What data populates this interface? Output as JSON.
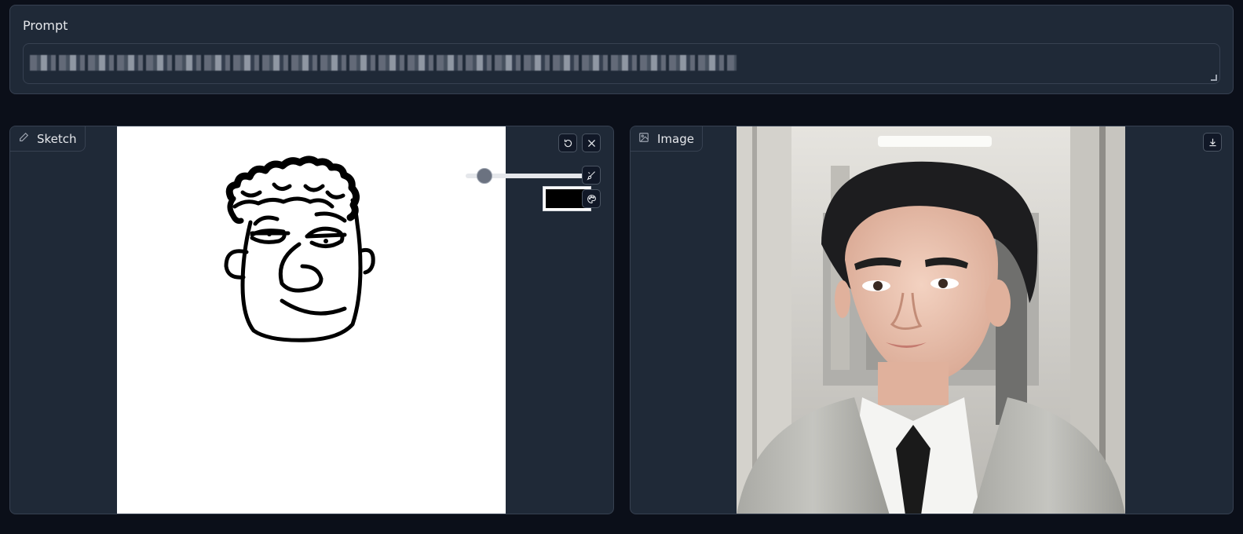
{
  "prompt": {
    "label": "Prompt",
    "value": ""
  },
  "sketch": {
    "tab_label": "Sketch",
    "tab_icon": "pencil-icon",
    "brush_size": 0.1,
    "brush_color": "#000000",
    "undo_icon": "undo-icon",
    "clear_icon": "close-icon",
    "brush_icon": "brush-icon",
    "palette_icon": "palette-icon"
  },
  "output": {
    "tab_label": "Image",
    "tab_icon": "image-icon",
    "download_icon": "download-icon"
  },
  "colors": {
    "page_bg": "#0b0f19",
    "panel_bg": "#1f2937",
    "border": "#374151"
  }
}
